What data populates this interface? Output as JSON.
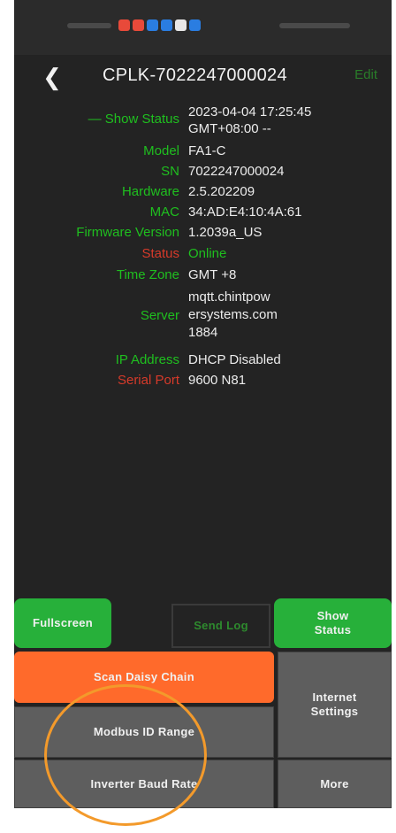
{
  "header": {
    "title": "CPLK-7022247000024",
    "action_label": "Edit"
  },
  "info": [
    {
      "label": "— Show Status",
      "value": "2023-04-04 17:25:45\nGMT+08:00 --",
      "label_color": "green",
      "value_color": "white"
    },
    {
      "label": "Model",
      "value": "FA1-C",
      "label_color": "green",
      "value_color": "white"
    },
    {
      "label": "SN",
      "value": "7022247000024",
      "label_color": "green",
      "value_color": "white"
    },
    {
      "label": "Hardware",
      "value": "2.5.202209",
      "label_color": "green",
      "value_color": "white"
    },
    {
      "label": "MAC",
      "value": "34:AD:E4:10:4A:61",
      "label_color": "green",
      "value_color": "white"
    },
    {
      "label": "Firmware Version",
      "value": "1.2039a_US",
      "label_color": "green",
      "value_color": "white"
    },
    {
      "label": "Status",
      "value": "Online",
      "label_color": "red",
      "value_color": "green"
    },
    {
      "label": "Time Zone",
      "value": "GMT +8",
      "label_color": "green",
      "value_color": "white"
    },
    {
      "label": "Server",
      "value": "mqtt.chintpow\nersystems.com\n1884",
      "label_color": "green",
      "value_color": "white"
    },
    {
      "label": "IP Address",
      "value": "DHCP Disabled",
      "label_color": "green",
      "value_color": "white"
    },
    {
      "label": "Serial Port",
      "value": "9600 N81",
      "label_color": "red",
      "value_color": "white"
    }
  ],
  "buttons": {
    "fullscreen": "Fullscreen",
    "log": "Send Log",
    "show_status": "Show\nStatus",
    "scan_daisy_chain": "Scan Daisy Chain",
    "internet_settings": "Internet\nSettings",
    "modbus_id_range": "Modbus ID Range",
    "inverter_baud_rate": "Inverter Baud Rate",
    "more": "More"
  },
  "colors": {
    "accent_green": "#27b03a",
    "accent_orange": "#ff6a2b",
    "annotation_circle": "#f39a2b",
    "label_red": "#d63a2a"
  }
}
